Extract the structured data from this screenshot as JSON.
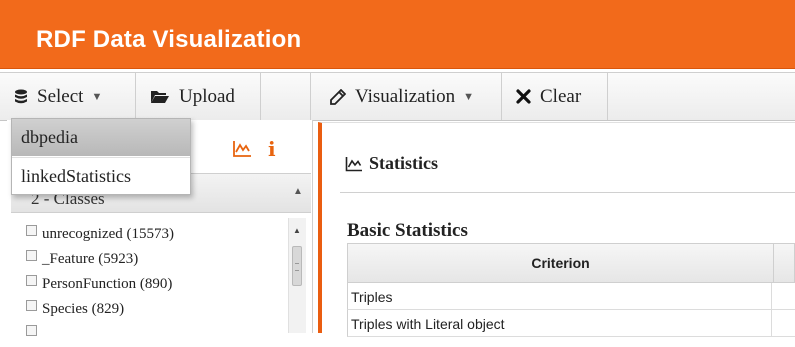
{
  "app": {
    "title": "RDF Data Visualization"
  },
  "toolbar": {
    "select_label": "Select",
    "upload_label": "Upload",
    "visualization_label": "Visualization",
    "clear_label": "Clear"
  },
  "select_dropdown": {
    "options": [
      "dbpedia",
      "linkedStatistics"
    ],
    "highlighted": "dbpedia"
  },
  "left_panel": {
    "info_icon_text": "i",
    "classes_header": {
      "label": "2 - Classes",
      "visible_text": "2 -  Classes"
    },
    "classes": [
      {
        "label": "unrecognized (15573)",
        "checked": false
      },
      {
        "label": "_Feature (5923)",
        "checked": false
      },
      {
        "label": "PersonFunction (890)",
        "checked": false
      },
      {
        "label": "Species (829)",
        "checked": false
      }
    ]
  },
  "content": {
    "section_title": "Statistics",
    "subsection_title": "Basic Statistics",
    "table": {
      "columns": [
        "Criterion",
        ""
      ],
      "rows": [
        "Triples",
        "Triples with Literal object"
      ]
    }
  },
  "colors": {
    "header_bg": "#f26a1b",
    "accent": "#ea5d10",
    "toolbar_bg": "#f2f2f2"
  }
}
